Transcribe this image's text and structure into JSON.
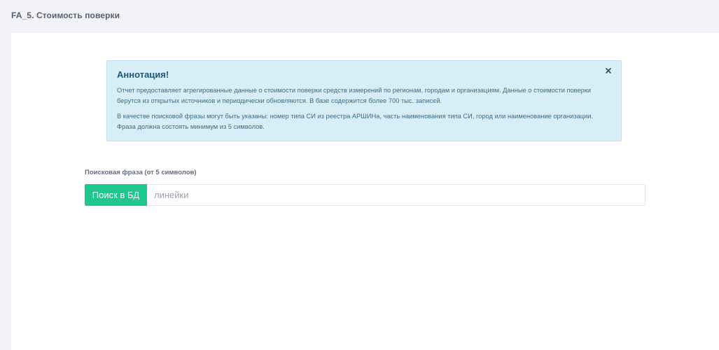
{
  "page": {
    "title": "FA_5. Стоимость поверки"
  },
  "annotation": {
    "title": "Аннотация!",
    "paragraph_1": "Отчет предоставляет агрегированные данные о стоимости поверки средств измерений по регионам, городам и организациям. Данные о стоимости поверки берутся из открытых источников и периодически обновляются. В базе содержится более 700 тыс. записей.",
    "paragraph_2": "В качестве поисковой фразы могут быть указаны: номер типа СИ из реестра АРШИНа, часть наименования типа СИ, город или наименование организации. Фраза должна состоять минимум из 5 символов.",
    "close_icon": "close-icon",
    "close_glyph": "×"
  },
  "search": {
    "label": "Поисковая фраза (от 5 символов)",
    "button_label": "Поиск в БД",
    "placeholder": "линейки",
    "value": ""
  },
  "colors": {
    "accent": "#1dc78e",
    "alert_background": "#d7eef6",
    "page_background": "#f2f3f8"
  }
}
